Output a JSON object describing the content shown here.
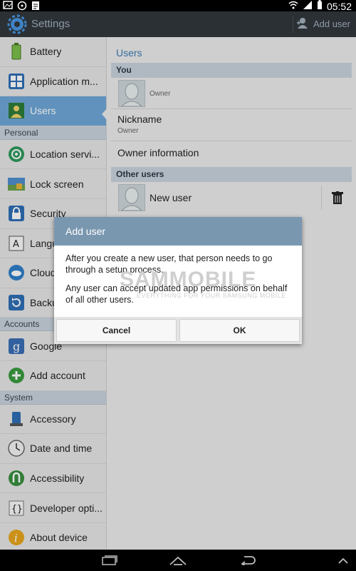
{
  "status": {
    "time": "05:52"
  },
  "actionbar": {
    "title": "Settings",
    "add_user": "Add user"
  },
  "sidebar": {
    "items_top": [
      {
        "label": "Battery",
        "icon": "battery-icon"
      },
      {
        "label": "Application m...",
        "icon": "application-manager-icon"
      },
      {
        "label": "Users",
        "icon": "users-icon"
      }
    ],
    "personal_header": "Personal",
    "personal": [
      {
        "label": "Location servi...",
        "icon": "location-icon"
      },
      {
        "label": "Lock screen",
        "icon": "lock-screen-icon"
      },
      {
        "label": "Security",
        "icon": "security-icon"
      },
      {
        "label": "Langu",
        "icon": "language-icon"
      },
      {
        "label": "Cloud",
        "icon": "cloud-icon"
      },
      {
        "label": "Backu",
        "icon": "backup-icon"
      }
    ],
    "accounts_header": "Accounts",
    "accounts": [
      {
        "label": "Google",
        "icon": "google-icon"
      },
      {
        "label": "Add account",
        "icon": "add-account-icon"
      }
    ],
    "system_header": "System",
    "system": [
      {
        "label": "Accessory",
        "icon": "accessory-icon"
      },
      {
        "label": "Date and time",
        "icon": "clock-icon"
      },
      {
        "label": "Accessibility",
        "icon": "accessibility-icon"
      },
      {
        "label": "Developer opti...",
        "icon": "developer-icon"
      },
      {
        "label": "About device",
        "icon": "info-icon"
      }
    ]
  },
  "users": {
    "title": "Users",
    "you_header": "You",
    "owner_label": "Owner",
    "nickname": "Nickname",
    "nickname_value": "Owner",
    "owner_information": "Owner information",
    "other_users_header": "Other users",
    "new_user": "New user"
  },
  "dialog": {
    "title": "Add user",
    "message1": "After you create a new user, that person needs to go through a setup process.",
    "message2": "Any user can accept updated app permissions on behalf of all other users.",
    "cancel": "Cancel",
    "ok": "OK"
  },
  "watermark": {
    "brand": "SAMMOBILE",
    "tagline": "EVERYTHING FOR YOUR SAMSUNG MOBILE"
  }
}
